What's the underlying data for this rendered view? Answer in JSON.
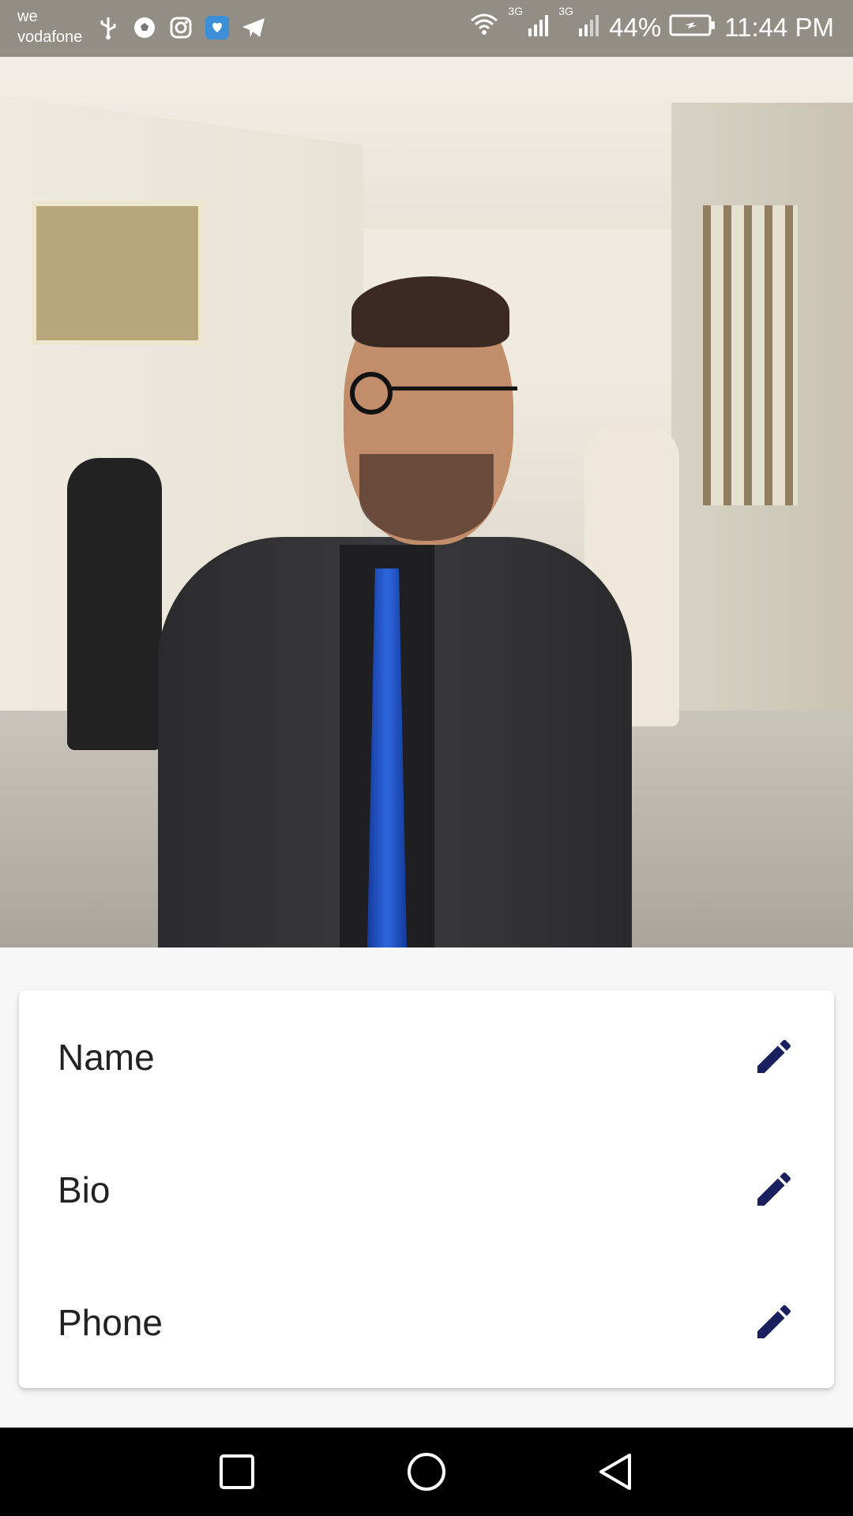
{
  "status_bar": {
    "carrier_line1": "we",
    "carrier_line2": "vodafone",
    "network_label_1": "3G",
    "network_label_2": "3G",
    "battery": "44%",
    "time": "11:44 PM",
    "notification_icons": [
      "usb-icon",
      "ball-icon",
      "instagram-icon",
      "heart-chat-icon",
      "telegram-icon"
    ]
  },
  "profile": {
    "photo_description_icon": "profile-photo"
  },
  "card": {
    "rows": [
      {
        "label": "Name",
        "icon": "edit-icon"
      },
      {
        "label": "Bio",
        "icon": "edit-icon"
      },
      {
        "label": "Phone",
        "icon": "edit-icon"
      }
    ],
    "accent_color": "#1a1f5e"
  },
  "nav_bar": {
    "buttons": [
      "recents-button",
      "home-button",
      "back-button"
    ]
  }
}
